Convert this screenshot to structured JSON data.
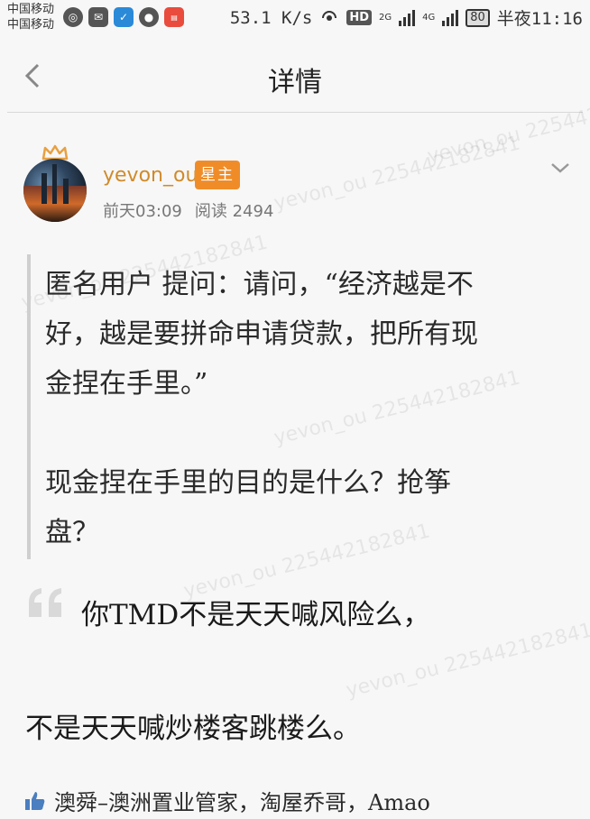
{
  "status_bar": {
    "carrier1": "中国移动",
    "carrier2": "中国移动",
    "net_speed": "53.1 K/s",
    "hd": "HD",
    "sig1": "2G",
    "sig2": "4G",
    "battery": "80",
    "time": "半夜11:16"
  },
  "header": {
    "title": "详情"
  },
  "author": {
    "name": "yevon_ou",
    "badge": "星主",
    "time": "前天03:09",
    "reads": "阅读 2494"
  },
  "post": {
    "question_lines": [
      "匿名用户  提问：请问，“经济越是不",
      "好，越是要拼命申请贷款，把所有现",
      "金捏在手里。”",
      "",
      "现金捏在手里的目的是什么？抢筝",
      "盘？"
    ],
    "reply1": "你TMD不是天天喊风险么，",
    "reply2": "不是天天喊炒楼客跳楼么。"
  },
  "likes": {
    "text": "澳舜–澳洲置业管家，淘屋乔哥，Amao"
  },
  "watermark": "yevon_ou 225442182841",
  "colors": {
    "badge": "#f08c28",
    "author": "#d08a2a"
  }
}
